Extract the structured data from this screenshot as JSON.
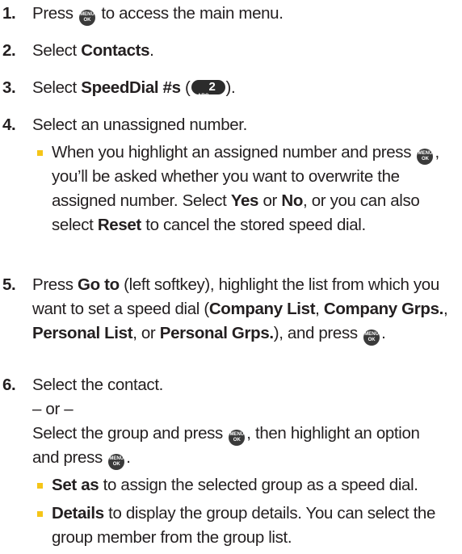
{
  "menu_key": {
    "line1": "MENU",
    "line2": "OK"
  },
  "abc_key": {
    "letters": "ABC",
    "digit": "2"
  },
  "steps": [
    {
      "number": "1.",
      "before": "Press",
      "after": "to access the main menu."
    },
    {
      "number": "2.",
      "before": "Select",
      "bold": "Contacts",
      "after": "."
    },
    {
      "number": "3.",
      "before": "Select",
      "bold": "SpeedDial #s",
      "open": "(",
      "close": ")."
    },
    {
      "number": "4.",
      "text": "Select an unassigned number.",
      "bullet": {
        "part1": "When you highlight an assigned number and press",
        "part2": ", you’ll be asked whether you want to overwrite the assigned number. Select",
        "yes": "Yes",
        "or": "or",
        "no": "No",
        "part3": ", or you can also select",
        "reset": "Reset",
        "part4": "to cancel the stored speed dial."
      }
    },
    {
      "number": "5.",
      "press": "Press",
      "goto": "Go to",
      "part1": "(left softkey), highlight the list from which you want to set a speed dial (",
      "company_list": "Company List",
      "comma1": ",",
      "company_grps": "Company Grps.",
      "comma2": ",",
      "personal_list": "Personal List",
      "or": ", or",
      "personal_grps": "Personal Grps.",
      "part2": "), and press",
      "end": "."
    },
    {
      "number": "6.",
      "line1": "Select the contact.",
      "or_line": "– or –",
      "line3a": "Select the group and press",
      "line3b": ", then highlight an option and press",
      "line3end": ".",
      "bullets": [
        {
          "bold": "Set as",
          "text": "to assign the selected group as a speed dial."
        },
        {
          "bold": "Details",
          "text": "to display the group details. You can select the group member from the group list."
        }
      ]
    }
  ]
}
